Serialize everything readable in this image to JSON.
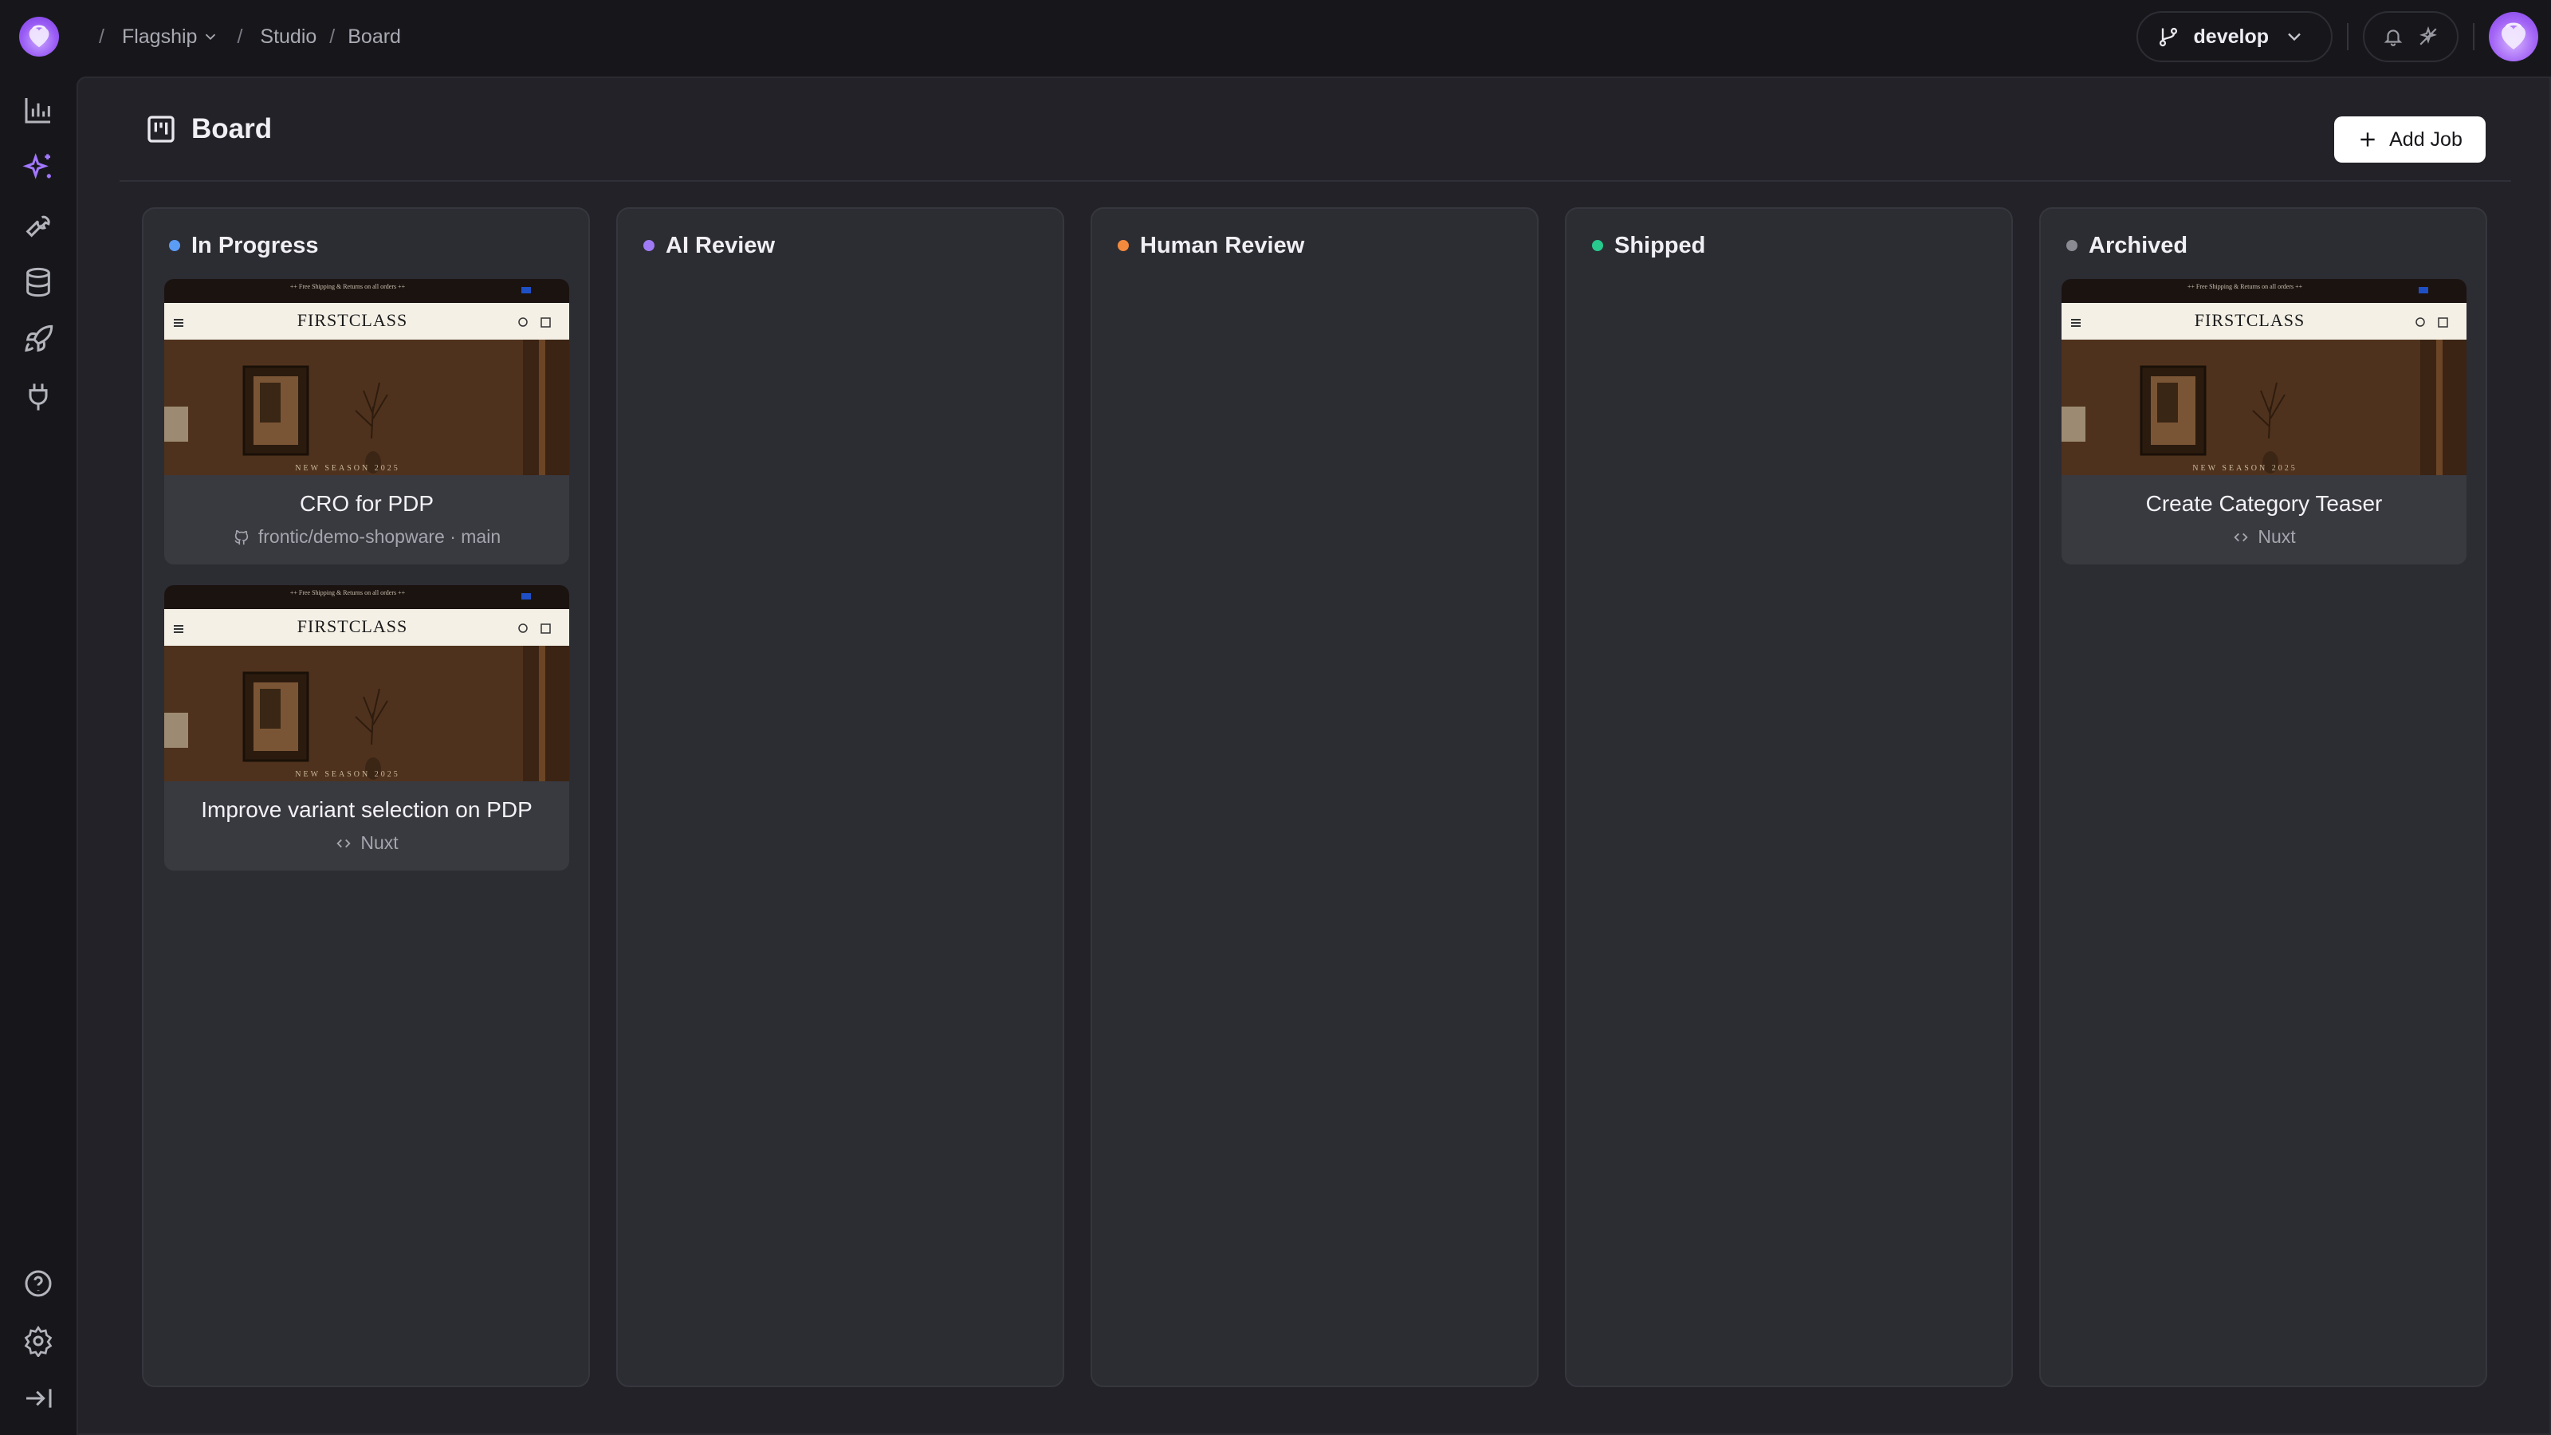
{
  "breadcrumb": {
    "org": "Flagship",
    "section": "Studio",
    "page": "Board"
  },
  "branch": {
    "name": "develop"
  },
  "page": {
    "title": "Board",
    "add_job_label": "Add Job"
  },
  "columns": [
    {
      "name": "In Progress",
      "color": "#5b9cf5",
      "cards": [
        {
          "title": "CRO for PDP",
          "meta": "frontic/demo-shopware · main",
          "meta_icon": "github-icon"
        },
        {
          "title": "Improve variant selection on PDP",
          "meta": "Nuxt",
          "meta_icon": "code-icon"
        }
      ]
    },
    {
      "name": "AI Review",
      "color": "#a07af5",
      "cards": []
    },
    {
      "name": "Human Review",
      "color": "#f28a3e",
      "cards": []
    },
    {
      "name": "Shipped",
      "color": "#27c98c",
      "cards": []
    },
    {
      "name": "Archived",
      "color": "#8a8a92",
      "cards": [
        {
          "title": "Create Category Teaser",
          "meta": "Nuxt",
          "meta_icon": "code-icon"
        }
      ]
    }
  ],
  "thumbnail": {
    "promo": "++ Free Shipping & Returns on all orders ++",
    "brand": "FIRSTCLASS",
    "hero_caption": "NEW SEASON 2025"
  },
  "sidebar_icons": [
    "analytics-icon",
    "sparkles-icon",
    "wrench-icon",
    "database-icon",
    "rocket-icon",
    "plug-icon",
    "help-icon",
    "settings-icon",
    "collapse-icon"
  ]
}
